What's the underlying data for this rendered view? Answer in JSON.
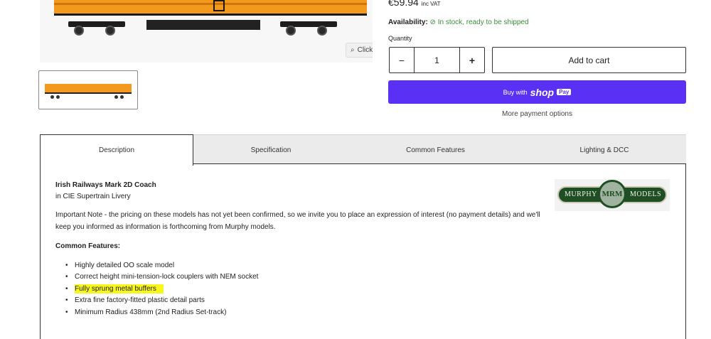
{
  "gallery": {
    "expand_label": "Click to expand",
    "expand_icon": "magnifier-icon",
    "thumbnail_alt": "Irish Railways Mark 2D Coach thumbnail"
  },
  "product": {
    "price": "€59.94",
    "price_suffix": "inc VAT",
    "availability_label": "Availability:",
    "availability_status": "In stock, ready to be shipped",
    "quantity_label": "Quantity",
    "quantity_value": "1",
    "decrement_symbol": "−",
    "increment_symbol": "+",
    "add_to_cart_label": "Add to cart",
    "shoppay_buy_with": "Buy with",
    "shoppay_shop": "shop",
    "shoppay_pay": "Pay",
    "more_payment_label": "More payment options"
  },
  "tabs": [
    {
      "label": "Description",
      "active": true
    },
    {
      "label": "Specification",
      "active": false
    },
    {
      "label": "Common Features",
      "active": false
    },
    {
      "label": "Lighting & DCC",
      "active": false
    }
  ],
  "description": {
    "title": "Irish Railways Mark 2D Coach",
    "subtitle": "in CIE Supertrain Livery",
    "note_line1": "Important Note - the pricing on these models has not yet been confirmed, so we invite you to place an expression of interest (no payment details) and we'll",
    "note_line2": "keep you informed as information is forthcoming from Murphy models.",
    "features_heading": "Common Features:",
    "features": [
      "Highly detailed OO scale model",
      "Correct height mini-tension-lock couplers with NEM socket",
      "Fully sprung metal buffers",
      "Extra fine factory-fitted plastic detail parts",
      "Minimum Radius 438mm (2nd Radius Set-track)"
    ],
    "highlighted_feature_index": 2,
    "highlight_color": "#f7f71e"
  },
  "logo": {
    "left_word": "MURPHY",
    "monogram": "MRM",
    "right_word": "MODELS"
  },
  "colors": {
    "shoppay": "#5a31f4",
    "stock_green": "#3b8d3b",
    "coach_orange": "#f39a1e"
  }
}
